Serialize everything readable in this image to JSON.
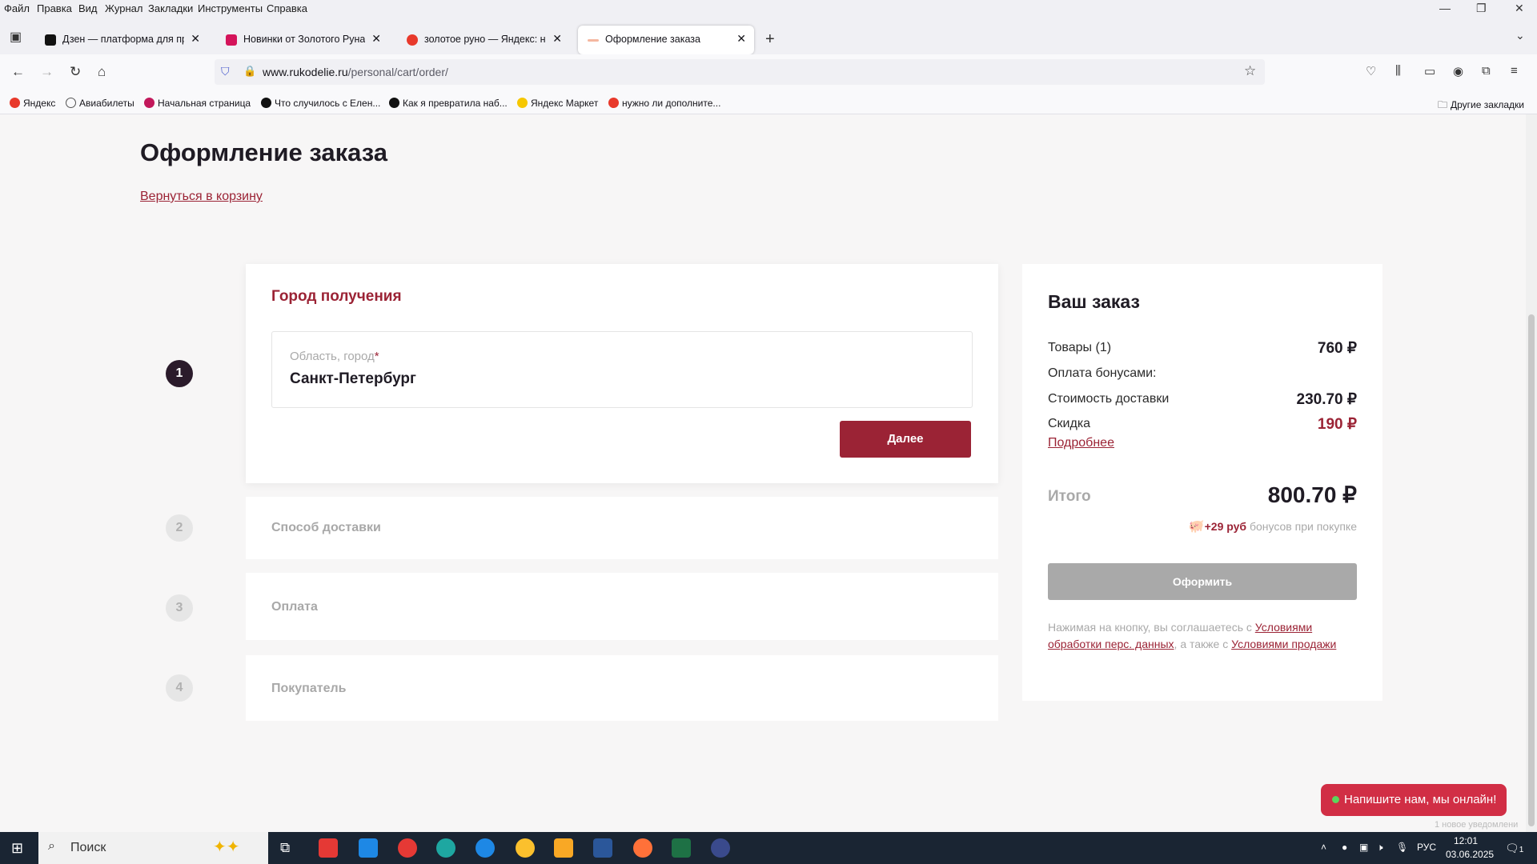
{
  "browser": {
    "menu": [
      "Файл",
      "Правка",
      "Вид",
      "Журнал",
      "Закладки",
      "Инструменты",
      "Справка"
    ],
    "tabs": [
      {
        "title": "Дзен — платформа для просм",
        "active": false
      },
      {
        "title": "Новинки от Золотого Руна - С",
        "active": false
      },
      {
        "title": "золотое руно — Яндекс: нашл",
        "active": false
      },
      {
        "title": "Оформление заказа",
        "active": true
      }
    ],
    "url_host": "www.rukodelie.ru",
    "url_path": "/personal/cart/order/",
    "bookmarks": [
      "Яндекс",
      "Авиабилеты",
      "Начальная страница",
      "Что случилось с Елен...",
      "Как я превратила наб...",
      "Яндекс Маркет",
      "нужно ли дополните..."
    ],
    "other_bookmarks": "Другие закладки"
  },
  "page": {
    "title": "Оформление заказа",
    "back_link": "Вернуться в корзину",
    "steps": [
      {
        "num": "1",
        "title": "Город получения"
      },
      {
        "num": "2",
        "title": "Способ доставки"
      },
      {
        "num": "3",
        "title": "Оплата"
      },
      {
        "num": "4",
        "title": "Покупатель"
      }
    ],
    "city_field": {
      "label": "Область, город",
      "required": "*",
      "value": "Санкт-Петербург"
    },
    "next_button": "Далее"
  },
  "summary": {
    "title": "Ваш заказ",
    "goods_label": "Товары (1)",
    "goods_amount": "760 ₽",
    "bonus_label": "Оплата бонусами:",
    "delivery_label": "Стоимость доставки",
    "delivery_amount": "230.70 ₽",
    "discount_label": "Скидка",
    "discount_amount": "190 ₽",
    "details_link": "Подробнее",
    "total_label": "Итого",
    "total_amount": "800.70 ₽",
    "bonus_gain": "+29 руб",
    "bonus_gain_text": "бонусов при покупке",
    "order_button": "Оформить",
    "agree_text1": "Нажимая на кнопку, вы соглашаетесь с",
    "agree_link1": "Условиями обработки перс. данных",
    "agree_text2": ", а также с",
    "agree_link2": "Условиями продажи"
  },
  "chat": {
    "label": "Напишите нам, мы онлайн!",
    "notice": "1 новое уведомлени"
  },
  "taskbar": {
    "search": "Поиск",
    "lang": "РУС",
    "time": "12:01",
    "date": "03.06.2025",
    "notif_count": "1"
  },
  "colors": {
    "accent": "#9b2335",
    "chat": "#d12e45"
  }
}
